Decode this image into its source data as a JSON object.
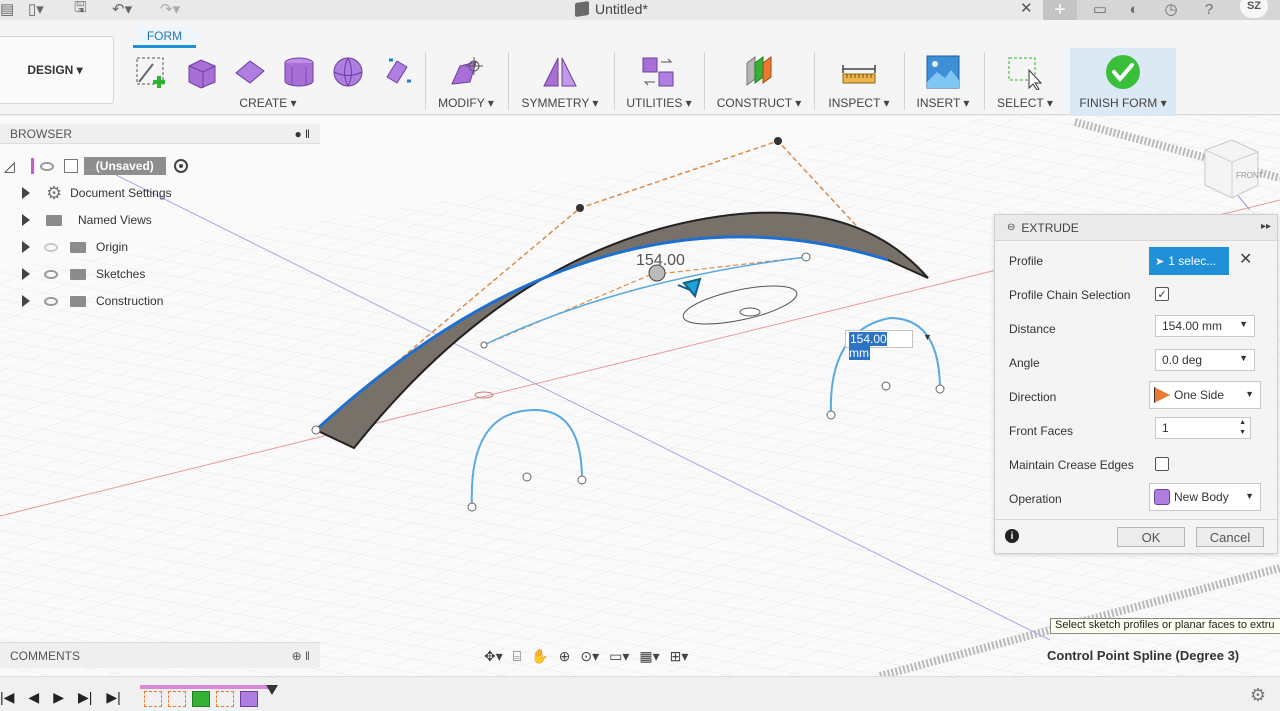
{
  "titlebar": {
    "doc_title": "Untitled*",
    "user_initials": "SZ"
  },
  "ribbon": {
    "workspace_label": "DESIGN ▾",
    "active_tab": "FORM",
    "groups": [
      {
        "label": "CREATE ▾"
      },
      {
        "label": "MODIFY ▾"
      },
      {
        "label": "SYMMETRY ▾"
      },
      {
        "label": "UTILITIES ▾"
      },
      {
        "label": "CONSTRUCT ▾"
      },
      {
        "label": "INSPECT ▾"
      },
      {
        "label": "INSERT ▾"
      },
      {
        "label": "SELECT ▾"
      },
      {
        "label": "FINISH FORM ▾"
      }
    ]
  },
  "browser": {
    "title": "BROWSER",
    "root": "(Unsaved)",
    "items": [
      {
        "label": "Document Settings",
        "icon": "gear-icon"
      },
      {
        "label": "Named Views",
        "icon": "folder-icon"
      },
      {
        "label": "Origin",
        "icon": "folder-icon"
      },
      {
        "label": "Sketches",
        "icon": "folder-icon"
      },
      {
        "label": "Construction",
        "icon": "folder-icon"
      }
    ]
  },
  "canvas": {
    "dimension_value": "154.00",
    "dimension_input": "154.00 mm"
  },
  "extrude": {
    "title": "EXTRUDE",
    "rows": {
      "profile": {
        "label": "Profile",
        "value": "1 selec..."
      },
      "profile_chain": {
        "label": "Profile Chain Selection",
        "checked": true
      },
      "distance": {
        "label": "Distance",
        "value": "154.00 mm"
      },
      "angle": {
        "label": "Angle",
        "value": "0.0 deg"
      },
      "direction": {
        "label": "Direction",
        "value": "One Side"
      },
      "front_faces": {
        "label": "Front Faces",
        "value": "1"
      },
      "maintain_crease": {
        "label": "Maintain Crease Edges",
        "checked": false
      },
      "operation": {
        "label": "Operation",
        "value": "New Body"
      }
    },
    "ok_label": "OK",
    "cancel_label": "Cancel"
  },
  "comments": {
    "title": "COMMENTS"
  },
  "tooltip": "Select sketch profiles or planar faces to extru",
  "status": "Control Point Spline (Degree 3)",
  "colors": {
    "accent": "#1e90d6",
    "profile_btn": "#1f8fd8",
    "spline": "#5aa9e0",
    "control_polygon": "#d98d4d",
    "body_face": "#78716a",
    "finish_green": "#3bbf3b"
  }
}
